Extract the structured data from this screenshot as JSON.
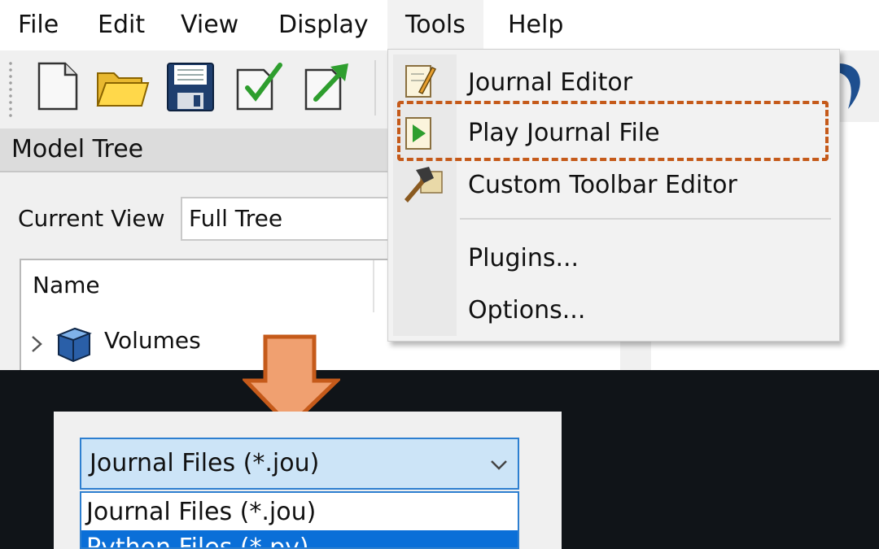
{
  "menubar": {
    "items": [
      "File",
      "Edit",
      "View",
      "Display",
      "Tools",
      "Help"
    ],
    "active": "Tools"
  },
  "toolbar": {
    "icons": [
      "new-file-icon",
      "open-folder-icon",
      "save-icon",
      "check-document-icon",
      "export-document-icon"
    ]
  },
  "model_tree": {
    "title": "Model Tree",
    "current_view_label": "Current View",
    "current_view_value": "Full Tree",
    "column_name": "Name",
    "rows": [
      {
        "label": "Volumes",
        "icon": "cube-icon"
      }
    ]
  },
  "tools_menu": {
    "items": [
      {
        "label": "Journal Editor",
        "icon": "journal-editor-icon"
      },
      {
        "label": "Play Journal File",
        "icon": "play-journal-icon",
        "highlighted": true
      },
      {
        "label": "Custom Toolbar Editor",
        "icon": "hammer-icon"
      },
      {
        "label": "Plugins...",
        "icon": ""
      },
      {
        "label": "Options...",
        "icon": ""
      }
    ]
  },
  "file_dialog": {
    "filter_selected": "Journal Files (*.jou)",
    "filter_options": [
      "Journal Files (*.jou)",
      "Python Files (*.py)"
    ]
  },
  "colors": {
    "highlight": "#c55a1a",
    "arrow_fill": "#f0a070",
    "selection": "#0a6fd8",
    "combo_bg": "#cce4f7"
  }
}
